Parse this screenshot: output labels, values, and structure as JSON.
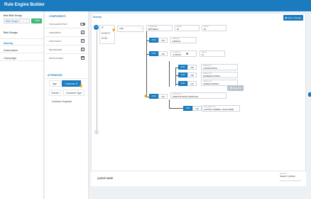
{
  "app": {
    "title": "Rule Engine Builder"
  },
  "sidebar": {
    "new_rule_group_label": "New Rule Group",
    "new_rule_group_value": "Rule Group 1",
    "add_label": "+ Add",
    "rule_groups_heading": "Rule Groups",
    "groups": [
      {
        "label": "Survey",
        "active": true
      },
      {
        "label": "Automation",
        "active": false
      },
      {
        "label": "Campaign",
        "active": false
      }
    ]
  },
  "components": {
    "heading": "COMPONENTS",
    "items": [
      {
        "label": "TOGGLE BUTTON",
        "icon": "toggle-icon"
      },
      {
        "label": "CHECKBOX",
        "icon": "checkbox-icon"
      },
      {
        "label": "TEXT INPUT",
        "icon": "text-input-icon"
      },
      {
        "label": "DROPDOWN",
        "icon": "dropdown-icon"
      },
      {
        "label": "DATE PICKER",
        "icon": "calendar-icon"
      }
    ]
  },
  "attributes": {
    "heading": "ATTRIBUTES",
    "items": [
      "Age",
      "Customer ID",
      "Gender",
      "Customer Type",
      "Customer Segment"
    ],
    "selected": "Customer ID"
  },
  "builder": {
    "title": "Survey",
    "save_label": "Save Changes",
    "root_toggle": "If",
    "root_dropdown_items": [
      "IF",
      "ELSE IF",
      "ELSE"
    ],
    "and_label": "AND",
    "or_label": "OR",
    "row1": {
      "field": "AGE",
      "op_cap": "OPERATOR",
      "op": "BETWEEN",
      "v1_cap": "VALUE",
      "v1": "18",
      "v2_cap": "VALUE",
      "v2": "30"
    },
    "row2": {
      "cap": "GENDER",
      "val": "FEMALE"
    },
    "row3": {
      "cap": "LOCATION",
      "val": "LONDON",
      "v_cap": "VALUE",
      "v": "10"
    },
    "row4a": {
      "cap": "CATEGORY",
      "val": "LANDSCAPING"
    },
    "row4b": {
      "cap": "CATEGORY",
      "val": "MODERNSTONES"
    },
    "row4c": {
      "cap": "CATEGORY",
      "val": "CEMENTWORKS"
    },
    "delete_label": "DELETE",
    "row5": {
      "cap": "CONDITION",
      "val": "DEMONSTRATE APPROVAL"
    },
    "row6": {
      "cap": "SUB CATEGORY",
      "val": "CAPITAL TOWERS, SOUTHSIDE"
    }
  },
  "footer": {
    "queue_label": "QUEUE NAME",
    "priority_cap": "PRIORITY",
    "priority_value": "SELECT QUEUE"
  },
  "colors": {
    "header": "#1b7bbf",
    "accent": "#1b7bbf",
    "add": "#3cb878"
  }
}
